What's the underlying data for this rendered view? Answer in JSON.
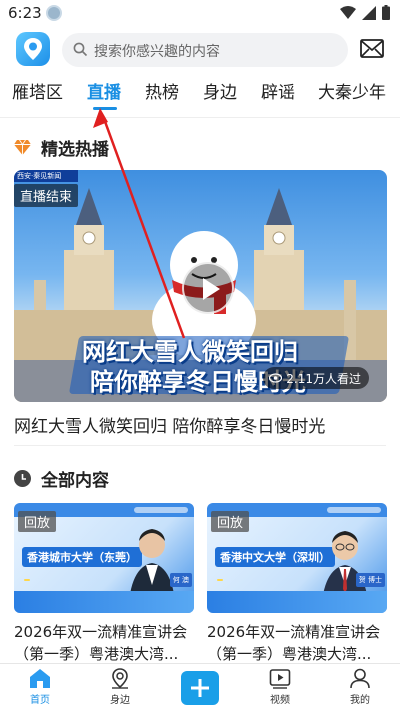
{
  "status_bar": {
    "time": "6:23"
  },
  "header": {
    "search_placeholder": "搜索你感兴趣的内容"
  },
  "tabs": [
    {
      "label": "雁塔区"
    },
    {
      "label": "直播"
    },
    {
      "label": "热榜"
    },
    {
      "label": "身边"
    },
    {
      "label": "辟谣"
    },
    {
      "label": "大秦少年"
    }
  ],
  "active_tab": "直播",
  "featured_section": {
    "title": "精选热播",
    "item": {
      "status_tag": "直播结束",
      "corner_logo": "西安·秦见新闻",
      "banner_line1": "网红大雪人微笑回归",
      "banner_line2": "陪你醉享冬日慢时光",
      "views": "2.11万人看过",
      "title": "网红大雪人微笑回归 陪你醉享冬日慢时光"
    }
  },
  "all_section": {
    "title": "全部内容",
    "cards": [
      {
        "tag": "回放",
        "university": "香港城市大学（东莞）",
        "person_name": "何 澳",
        "title_line1": "2026年双一流精准宣讲会",
        "title_line2": "（第一季）粤港澳大湾..."
      },
      {
        "tag": "回放",
        "university": "香港中文大学（深圳）",
        "person_name": "贺 博士",
        "title_line1": "2026年双一流精准宣讲会",
        "title_line2": "（第一季）粤港澳大湾..."
      }
    ]
  },
  "bottom_nav": [
    {
      "label": "首页",
      "icon": "home-icon",
      "active": true
    },
    {
      "label": "身边",
      "icon": "location-person-icon",
      "active": false
    },
    {
      "label": "",
      "icon": "plus-icon",
      "active": false
    },
    {
      "label": "视频",
      "icon": "video-icon",
      "active": false
    },
    {
      "label": "我的",
      "icon": "user-icon",
      "active": false
    }
  ],
  "colors": {
    "accent": "#1a8fe3",
    "annotation": "#e02020"
  }
}
